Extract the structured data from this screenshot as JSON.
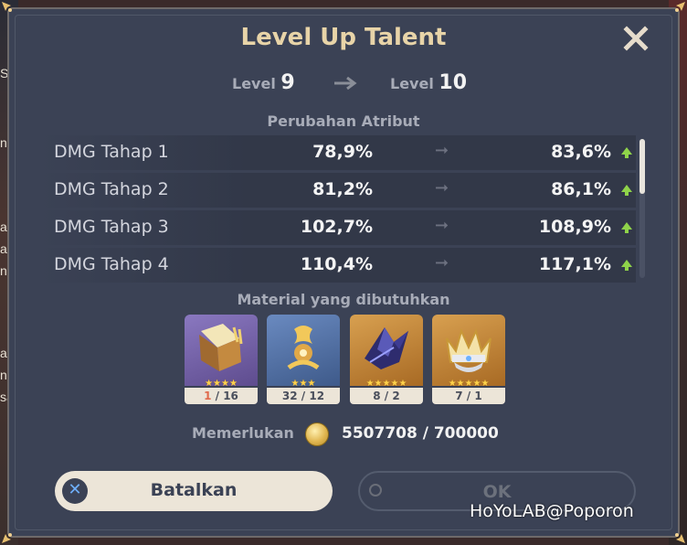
{
  "dialog": {
    "title": "Level Up Talent",
    "level_label": "Level",
    "level_from": "9",
    "level_to": "10"
  },
  "attributes": {
    "header": "Perubahan Atribut",
    "rows": [
      {
        "name": "DMG Tahap 1",
        "old": "78,9%",
        "new": "83,6%"
      },
      {
        "name": "DMG Tahap 2",
        "old": "81,2%",
        "new": "86,1%"
      },
      {
        "name": "DMG Tahap 3",
        "old": "102,7%",
        "new": "108,9%"
      },
      {
        "name": "DMG Tahap 4",
        "old": "110,4%",
        "new": "117,1%"
      }
    ]
  },
  "materials": {
    "header": "Material yang dibutuhkan",
    "items": [
      {
        "icon": "talent-book-icon",
        "stars": "★★★★",
        "have": "1",
        "need": "16",
        "bg": "#6b5a9a"
      },
      {
        "icon": "golden-relic-icon",
        "stars": "★★★",
        "have": "32",
        "need": "12",
        "bg": "#4a6a9a"
      },
      {
        "icon": "dark-crystal-icon",
        "stars": "★★★★★",
        "have": "8",
        "need": "2",
        "bg": "#b8782a"
      },
      {
        "icon": "crown-icon",
        "stars": "★★★★★",
        "have": "7",
        "need": "1",
        "bg": "#b8782a"
      }
    ]
  },
  "cost": {
    "label": "Memerlukan",
    "value": "5507708 / 700000"
  },
  "buttons": {
    "cancel": "Batalkan",
    "ok": "OK"
  },
  "watermark": "HoYoLAB@Poporon",
  "edge_text": [
    "Sk",
    "n",
    "a",
    "a",
    "ng",
    "at",
    "ng",
    "sa"
  ]
}
